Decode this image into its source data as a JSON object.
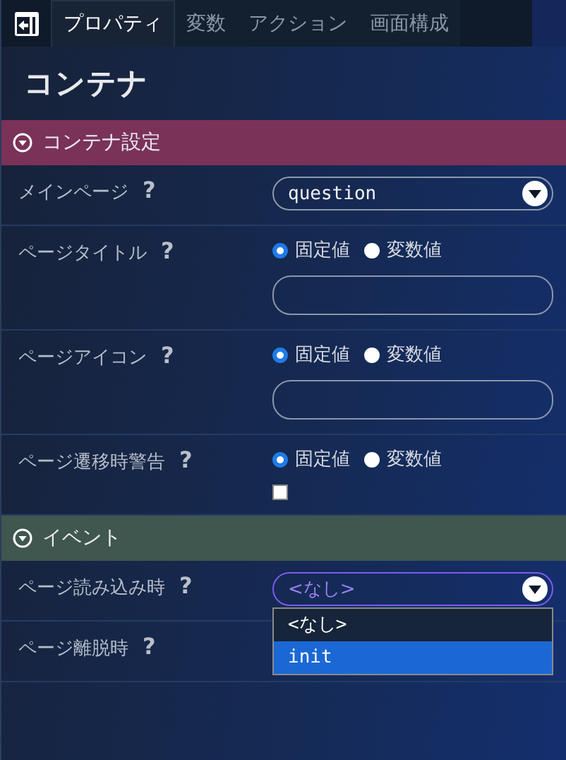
{
  "tabs": [
    {
      "label": "プロパティ",
      "selected": true
    },
    {
      "label": "変数",
      "selected": false
    },
    {
      "label": "アクション",
      "selected": false
    },
    {
      "label": "画面構成",
      "selected": false
    }
  ],
  "heading": "コンテナ",
  "sections": [
    {
      "title": "コンテナ設定",
      "color": "#7a3259",
      "expanded": true,
      "rows": [
        {
          "kind": "select",
          "label": "メインページ",
          "help": "?",
          "value": "question",
          "focused": false
        },
        {
          "kind": "radio_text",
          "label": "ページタイトル",
          "help": "?",
          "options": [
            {
              "label": "固定値",
              "selected": true
            },
            {
              "label": "変数値",
              "selected": false
            }
          ]
        },
        {
          "kind": "radio_text",
          "label": "ページアイコン",
          "help": "?",
          "options": [
            {
              "label": "固定値",
              "selected": true
            },
            {
              "label": "変数値",
              "selected": false
            }
          ]
        },
        {
          "kind": "radio_check",
          "label": "ページ遷移時警告",
          "help": "?",
          "checked": false,
          "options": [
            {
              "label": "固定値",
              "selected": true
            },
            {
              "label": "変数値",
              "selected": false
            }
          ]
        }
      ]
    },
    {
      "title": "イベント",
      "color": "#3f574e",
      "expanded": true,
      "rows": [
        {
          "kind": "select",
          "label": "ページ読み込み時",
          "help": "?",
          "value": "<なし>",
          "focused": true,
          "dropdown": [
            {
              "label": "<なし>",
              "highlighted": false
            },
            {
              "label": "init",
              "highlighted": true
            }
          ]
        },
        {
          "kind": "label_only",
          "label": "ページ離脱時",
          "help": "?"
        }
      ]
    }
  ]
}
